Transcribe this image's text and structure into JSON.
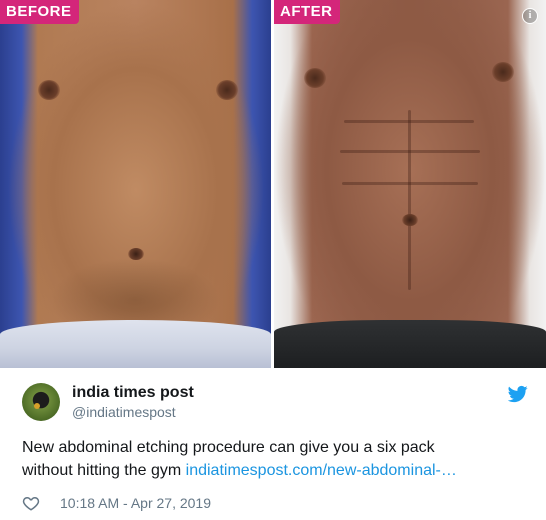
{
  "media": {
    "before_label": "BEFORE",
    "after_label": "AFTER",
    "info_icon": "info-icon"
  },
  "tweet": {
    "display_name": "india times post",
    "handle": "@indiatimespost",
    "text_line1": "New abdominal etching procedure can give you a six pack",
    "text_line2_prefix": "without hitting the gym ",
    "link_text": "indiatimespost.com/new-abdominal-…",
    "timestamp": "10:18 AM - Apr 27, 2019"
  },
  "icons": {
    "bird": "twitter-bird-icon",
    "heart": "heart-icon"
  },
  "colors": {
    "link": "#1b95e0",
    "tag_background": "#d4267a",
    "secondary_text": "#657786",
    "twitter_blue": "#1da1f2"
  }
}
